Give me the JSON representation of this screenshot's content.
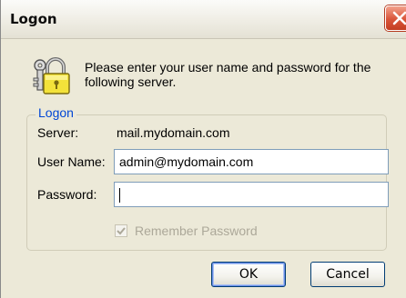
{
  "window": {
    "title": "Logon"
  },
  "message": "Please enter your user name and password for the following server.",
  "group": {
    "legend": "Logon"
  },
  "server": {
    "label": "Server:",
    "value": "mail.mydomain.com"
  },
  "username": {
    "label": "User Name:",
    "value": "admin@mydomain.com"
  },
  "password": {
    "label": "Password:",
    "value": ""
  },
  "remember": {
    "label": "Remember Password",
    "checked": true,
    "enabled": false
  },
  "buttons": {
    "ok": "OK",
    "cancel": "Cancel"
  },
  "icons": {
    "lock": "padlock-keys-icon",
    "close": "close-icon"
  },
  "colors": {
    "group_legend": "#0046d5",
    "close_button": "#d9553a",
    "disabled_text": "#aca899"
  }
}
